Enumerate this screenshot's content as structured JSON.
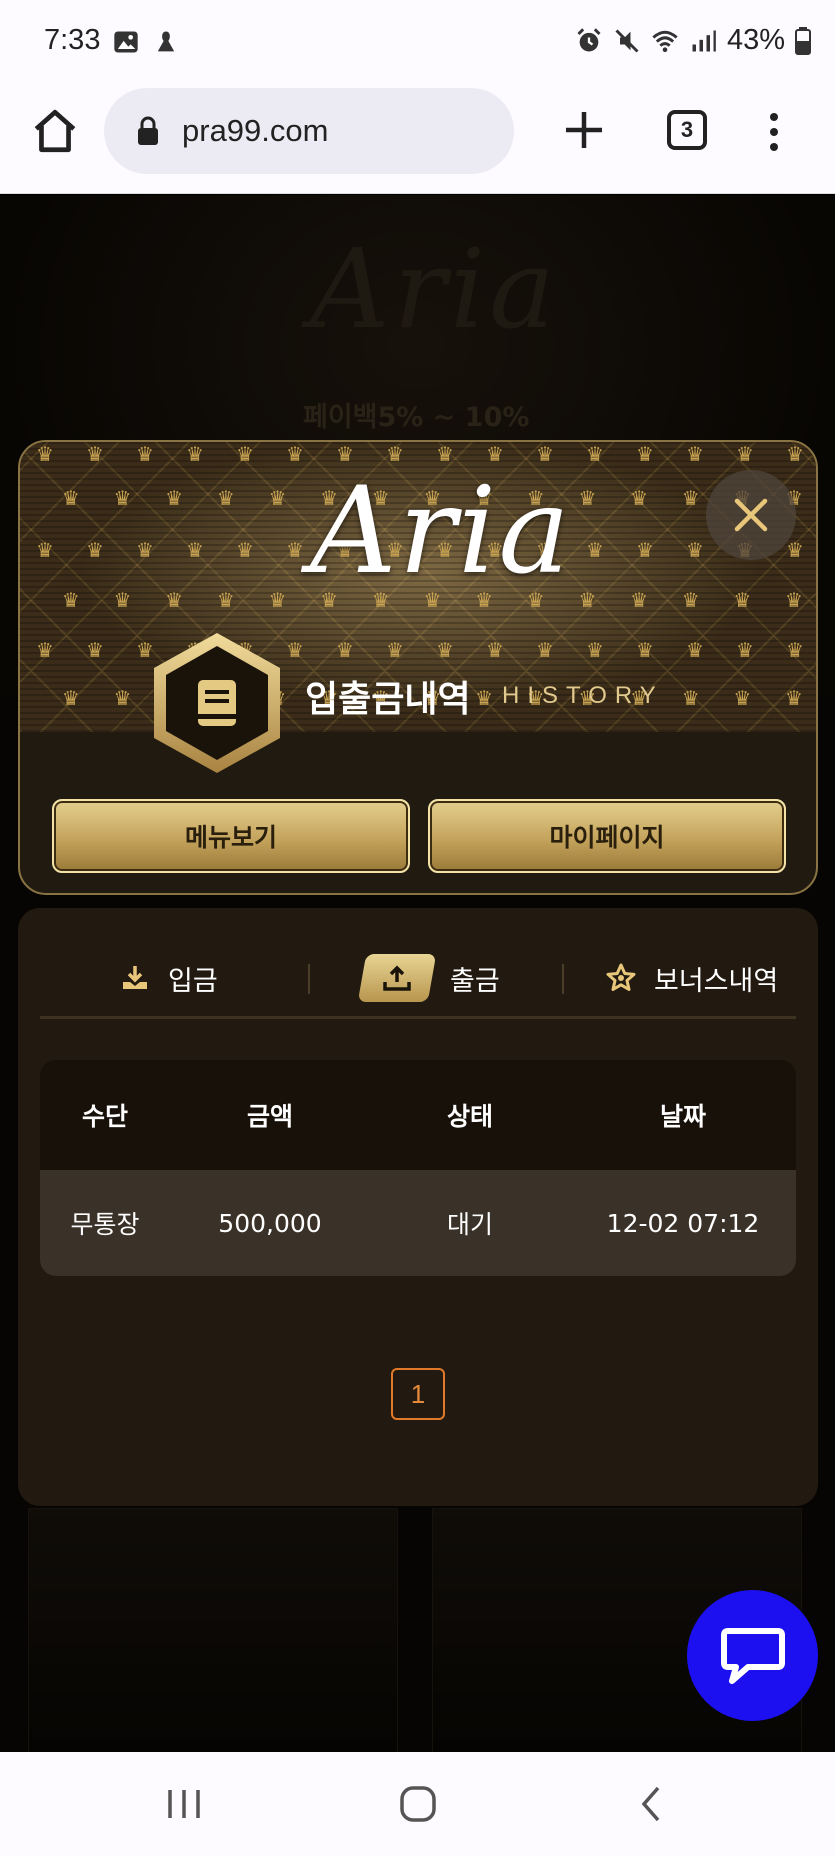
{
  "status_bar": {
    "time": "7:33",
    "battery": "43%",
    "icons": [
      "image-icon",
      "app-icon",
      "alarm-icon",
      "mute-icon",
      "wifi-icon",
      "signal-icon",
      "battery-icon"
    ]
  },
  "browser": {
    "url": "pra99.com",
    "tab_count": "3",
    "icons": [
      "home-icon",
      "lock-icon",
      "plus-icon",
      "tabs-icon",
      "more-vert-icon"
    ]
  },
  "background": {
    "logo_text": "Aria",
    "promo_text": "페이백5% ~ 10%"
  },
  "modal": {
    "logo_text": "Aria",
    "title_kr": "입출금내역",
    "title_en": "HISTORY",
    "buttons": {
      "menu": "메뉴보기",
      "mypage": "마이페이지"
    }
  },
  "history": {
    "tabs": [
      {
        "label": "입금",
        "icon": "download-icon",
        "active": false
      },
      {
        "label": "출금",
        "icon": "upload-icon",
        "active": true
      },
      {
        "label": "보너스내역",
        "icon": "star-icon",
        "active": false
      }
    ],
    "columns": [
      "수단",
      "금액",
      "상태",
      "날짜"
    ],
    "rows": [
      [
        "무통장",
        "500,000",
        "대기",
        "12-02 07:12"
      ]
    ],
    "pagination": {
      "current": "1"
    }
  },
  "colors": {
    "gold": "#c9a452",
    "panel": "#221a10",
    "page_accent": "#e07a2a",
    "chat_button": "#1d10f0"
  }
}
